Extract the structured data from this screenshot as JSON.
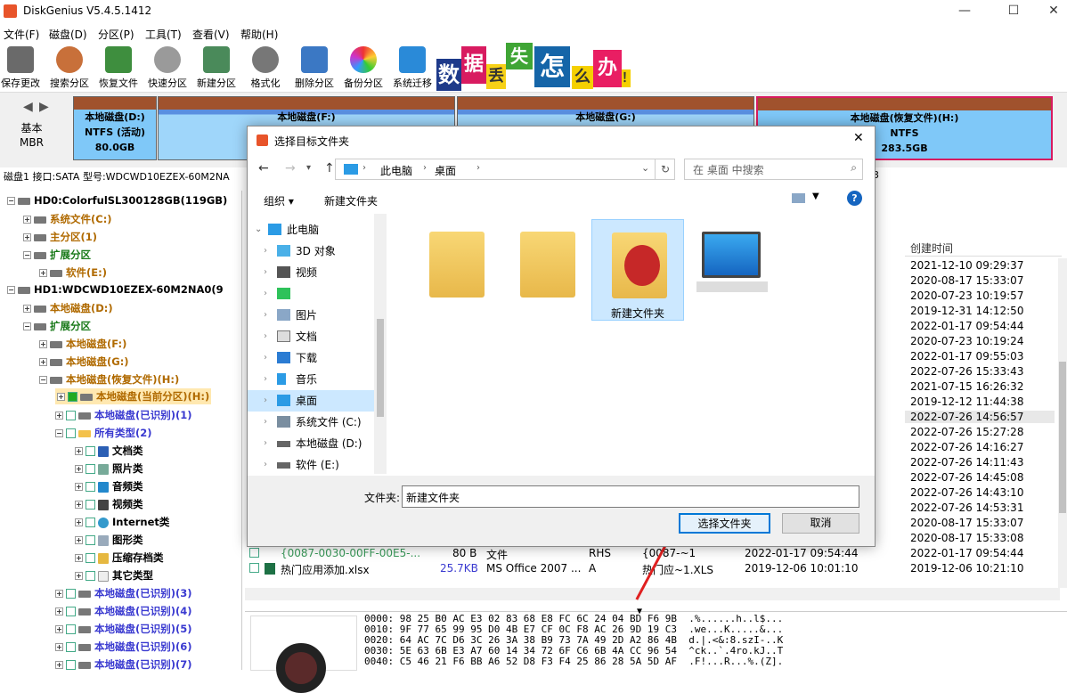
{
  "app": {
    "title": "DiskGenius V5.4.5.1412",
    "min": "—",
    "max": "☐",
    "close": "✕"
  },
  "menu": [
    "文件(F)",
    "磁盘(D)",
    "分区(P)",
    "工具(T)",
    "查看(V)",
    "帮助(H)"
  ],
  "toolbar": [
    "保存更改",
    "搜索分区",
    "恢复文件",
    "快速分区",
    "新建分区",
    "格式化",
    "删除分区",
    "备份分区",
    "系统迁移"
  ],
  "banner": [
    "数",
    "据",
    "丢",
    "失",
    "怎",
    "么",
    "办",
    "！"
  ],
  "disk_map": {
    "nav_label": "基本\nMBR",
    "partitions": [
      {
        "name": "本地磁盘(D:)",
        "fs": "NTFS (活动)",
        "size": "80.0GB"
      },
      {
        "name": "本地磁盘(F:)"
      },
      {
        "name": "本地磁盘(G:)"
      },
      {
        "name": "本地磁盘(恢复文件)(H:)",
        "fs": "NTFS",
        "size": "283.5GB"
      }
    ]
  },
  "disk_info": "磁盘1 接口:SATA  型号:WDCWD10EZEX-60M2NA",
  "disk_info_tail": "3",
  "tree": [
    {
      "label": "HD0:ColorfulSL300128GB(119GB)"
    },
    {
      "label": "系统文件(C:)"
    },
    {
      "label": "主分区(1)"
    },
    {
      "label": "扩展分区"
    },
    {
      "label": "软件(E:)"
    },
    {
      "label": "HD1:WDCWD10EZEX-60M2NA0(9"
    },
    {
      "label": "本地磁盘(D:)"
    },
    {
      "label": "扩展分区"
    },
    {
      "label": "本地磁盘(F:)"
    },
    {
      "label": "本地磁盘(G:)"
    },
    {
      "label": "本地磁盘(恢复文件)(H:)"
    },
    {
      "label": "本地磁盘(当前分区)(H:)"
    },
    {
      "label": "本地磁盘(已识别)(1)"
    },
    {
      "label": "所有类型(2)"
    },
    {
      "label": "文档类"
    },
    {
      "label": "照片类"
    },
    {
      "label": "音频类"
    },
    {
      "label": "视频类"
    },
    {
      "label": "Internet类"
    },
    {
      "label": "图形类"
    },
    {
      "label": "压缩存档类"
    },
    {
      "label": "其它类型"
    },
    {
      "label": "本地磁盘(已识别)(3)"
    },
    {
      "label": "本地磁盘(已识别)(4)"
    },
    {
      "label": "本地磁盘(已识别)(5)"
    },
    {
      "label": "本地磁盘(已识别)(6)"
    },
    {
      "label": "本地磁盘(已识别)(7)"
    }
  ],
  "list": {
    "col_created": "创建时间",
    "created": [
      "2021-12-10 09:29:37",
      "2020-08-17 15:33:07",
      "2020-07-23 10:19:57",
      "2019-12-31 14:12:50",
      "2022-01-17 09:54:44",
      "2020-07-23 10:19:24",
      "2022-01-17 09:55:03",
      "2022-07-26 15:33:43",
      "2021-07-15 16:26:32",
      "2019-12-12 11:44:38",
      "2022-07-26 14:56:57",
      "2022-07-26 15:27:28",
      "2022-07-26 14:16:27",
      "2022-07-26 14:11:43",
      "2022-07-26 14:45:08",
      "2022-07-26 14:43:10",
      "2022-07-26 14:53:31",
      "2020-08-17 15:33:07",
      "2020-08-17 15:33:08",
      "2022-01-17 09:54:44",
      "2019-12-06 10:21:10"
    ],
    "rows": [
      {
        "name": "{0087-0030-00FF-00E5-...",
        "size": "80 B",
        "type": "文件",
        "attr": "RHS",
        "short": "{0087-~1",
        "modified": "2022-01-17 09:54:44"
      },
      {
        "name": "热门应用添加.xlsx",
        "size": "25.7KB",
        "type": "MS Office 2007 ...",
        "attr": "A",
        "short": "热门应~1.XLS",
        "modified": "2019-12-06 10:01:10"
      }
    ]
  },
  "hex": [
    "0000: 98 25 B0 AC E3 02 83 68 E8 FC 6C 24 04 BD F6 9B  .%......h..l$...",
    "0010: 9F 77 65 99 95 D0 4B E7 CF 0C F8 AC 26 9D 19 C3  .we...K.....&...",
    "0020: 64 AC 7C D6 3C 26 3A 38 B9 73 7A 49 2D A2 86 4B  d.|.<&:8.szI-..K",
    "0030: 5E 63 6B E3 A7 60 14 34 72 6F C6 6B 4A CC 96 54  ^ck..`.4ro.kJ..T",
    "0040: C5 46 21 F6 BB A6 52 D8 F3 F4 25 86 28 5A 5D AF  .F!...R...%.(Z]."
  ],
  "dialog": {
    "title": "选择目标文件夹",
    "close": "✕",
    "path": [
      "此电脑",
      "桌面"
    ],
    "search_placeholder": "在 桌面 中搜索",
    "organize": "组织 ▾",
    "new_folder": "新建文件夹",
    "help": "?",
    "nav": [
      "此电脑",
      "3D 对象",
      "视频",
      "",
      "图片",
      "文档",
      "下载",
      "音乐",
      "桌面",
      "系统文件 (C:)",
      "本地磁盘 (D:)",
      "软件 (E:)"
    ],
    "items": [
      "",
      "",
      "新建文件夹",
      ""
    ],
    "folder_label": "文件夹:",
    "folder_value": "新建文件夹",
    "ok": "选择文件夹",
    "cancel": "取消"
  },
  "colors": {
    "accent": "#0078d7",
    "partition_fill": "#7fc8f8",
    "partition_top": "#a0522d",
    "selected": "#cce8ff",
    "arrow": "#e02020"
  }
}
